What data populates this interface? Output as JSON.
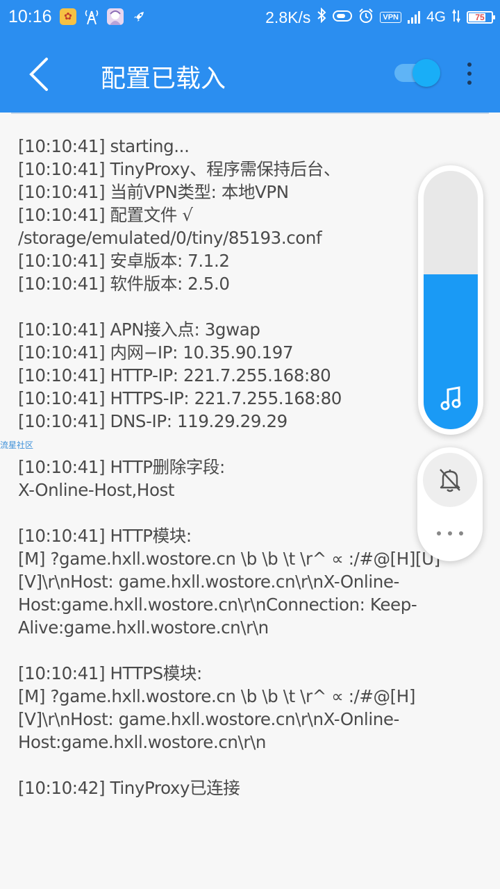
{
  "status_bar": {
    "time": "10:16",
    "net_speed": "2.8K/s",
    "vpn_badge": "VPN",
    "network_type": "4G",
    "battery_percent": "75",
    "battery_level": 0.75
  },
  "app_bar": {
    "title": "配置已载入",
    "toggle_on": true
  },
  "log_lines": [
    "[10:10:41] starting...",
    "[10:10:41] TinyProxy、程序需保持后台、",
    "[10:10:41] 当前VPN类型: 本地VPN",
    "[10:10:41] 配置文件 √",
    "/storage/emulated/0/tiny/85193.conf",
    "[10:10:41] 安卓版本: 7.1.2",
    "[10:10:41] 软件版本: 2.5.0",
    "",
    "[10:10:41] APN接入点: 3gwap",
    "[10:10:41] 内网−IP: 10.35.90.197",
    "[10:10:41] HTTP-IP: 221.7.255.168:80",
    "[10:10:41] HTTPS-IP: 221.7.255.168:80",
    "[10:10:41] DNS-IP: 119.29.29.29",
    "",
    "[10:10:41] HTTP删除字段:",
    "X-Online-Host,Host",
    "",
    "[10:10:41] HTTP模块:",
    "[M] ?game.hxll.wostore.cn \\b \\b \\t \\r^ ∝ :/#@[H][U]",
    "[V]\\r\\nHost: game.hxll.wostore.cn\\r\\nX-Online-",
    "Host:game.hxll.wostore.cn\\r\\nConnection: Keep-",
    "Alive:game.hxll.wostore.cn\\r\\n",
    "",
    "[10:10:41] HTTPS模块:",
    "[M] ?game.hxll.wostore.cn \\b \\b \\t \\r^ ∝ :/#@[H]",
    "[V]\\r\\nHost: game.hxll.wostore.cn\\r\\nX-Online-",
    "Host:game.hxll.wostore.cn\\r\\n",
    "",
    "[10:10:42] TinyProxy已连接"
  ],
  "watermark": "流星社区",
  "volume": {
    "level": 0.6,
    "accent": "#1a9af5"
  },
  "colors": {
    "primary": "#2b8ef0",
    "log_text": "#4a4a4a"
  }
}
